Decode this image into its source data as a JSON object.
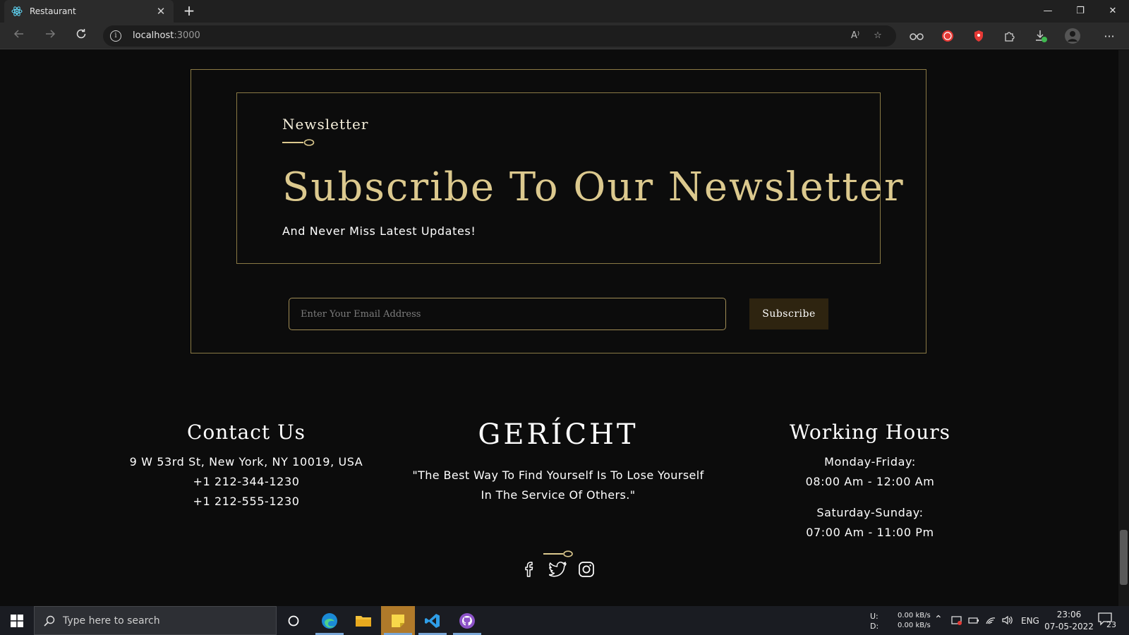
{
  "browser": {
    "tab_title": "Restaurant",
    "url_host": "localhost",
    "url_port": ":3000",
    "tab_close": "✕",
    "new_tab": "+",
    "window_controls": [
      "—",
      "❐",
      "✕"
    ],
    "more_menu": "···"
  },
  "newsletter": {
    "subheading": "Newsletter",
    "title": "Subscribe To Our Newsletter",
    "description": "And Never Miss Latest Updates!",
    "email_placeholder": "Enter Your Email Address",
    "subscribe_label": "Subscribe"
  },
  "footer": {
    "contact": {
      "title": "Contact Us",
      "address": "9 W 53rd St, New York, NY 10019, USA",
      "phone1": "+1 212-344-1230",
      "phone2": "+1 212-555-1230"
    },
    "logo": "GERÍCHT",
    "quote_line1": "\"The Best Way To Find Yourself Is To Lose Yourself",
    "quote_line2": "In The Service Of Others.\"",
    "hours": {
      "title": "Working Hours",
      "weekdays_label": "Monday-Friday:",
      "weekdays_time": "08:00 Am - 12:00 Am",
      "weekend_label": "Saturday-Sunday:",
      "weekend_time": "07:00 Am - 11:00 Pm"
    },
    "social_icons": [
      "facebook-icon",
      "twitter-icon",
      "instagram-icon"
    ]
  },
  "taskbar": {
    "search_placeholder": "Type here to search",
    "net_upload_label": "U:",
    "net_download_label": "D:",
    "net_upload_value": "0.00 kB/s",
    "net_download_value": "0.00 kB/s",
    "language": "ENG",
    "time": "23:06",
    "date": "07-05-2022",
    "notification_count": "23"
  },
  "colors": {
    "gold": "#dcc98e",
    "border_gold": "#8a7a45",
    "background": "#0c0c0c",
    "button_bg": "#2e2410"
  }
}
